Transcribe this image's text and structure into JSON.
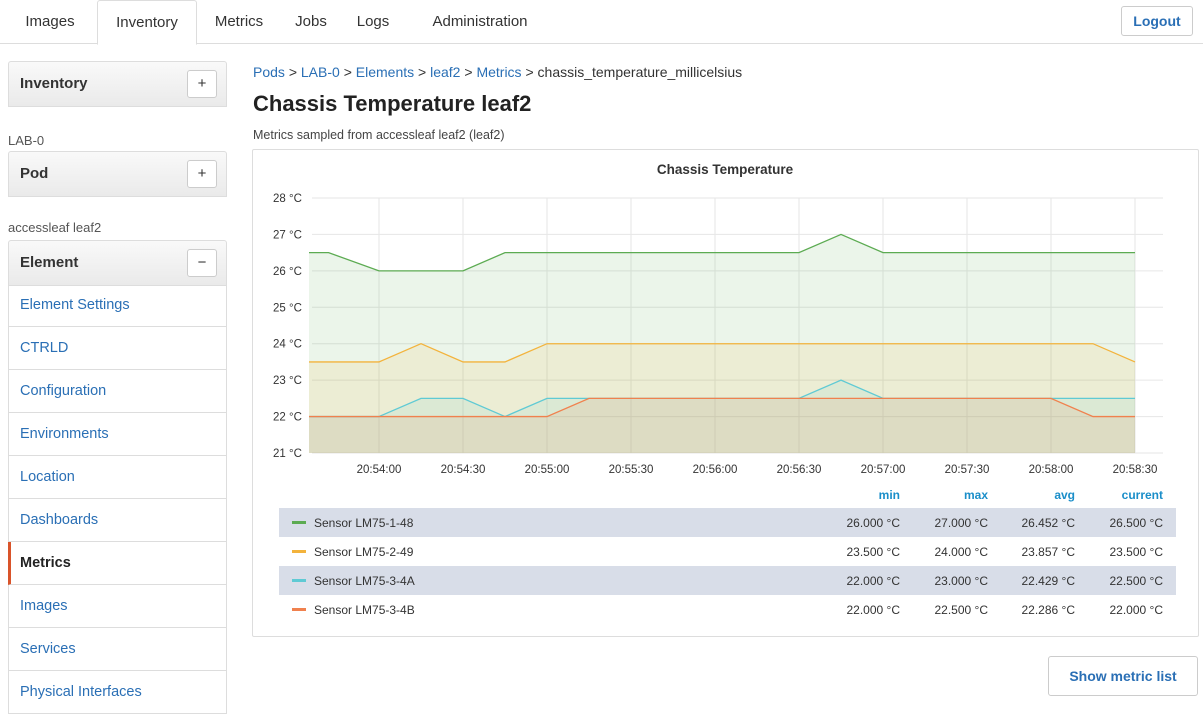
{
  "nav": {
    "tabs": [
      "Images",
      "Inventory",
      "Metrics",
      "Jobs",
      "Logs",
      "Administration"
    ],
    "active": "Inventory",
    "logout_label": "Logout"
  },
  "sidebar": {
    "inventory_title": "Inventory",
    "inventory_btn": "+",
    "pod_context": "LAB-0",
    "pod_title": "Pod",
    "pod_btn": "+",
    "element_context": "accessleaf leaf2",
    "element_title": "Element",
    "element_btn": "−",
    "items": [
      {
        "label": "Element Settings",
        "active": false
      },
      {
        "label": "CTRLD",
        "active": false
      },
      {
        "label": "Configuration",
        "active": false
      },
      {
        "label": "Environments",
        "active": false
      },
      {
        "label": "Location",
        "active": false
      },
      {
        "label": "Dashboards",
        "active": false
      },
      {
        "label": "Metrics",
        "active": true
      },
      {
        "label": "Images",
        "active": false
      },
      {
        "label": "Services",
        "active": false
      },
      {
        "label": "Physical Interfaces",
        "active": false
      }
    ]
  },
  "breadcrumb": {
    "items": [
      "Pods",
      "LAB-0",
      "Elements",
      "leaf2",
      "Metrics"
    ],
    "separator": ">",
    "current": "chassis_temperature_millicelsius"
  },
  "page": {
    "title": "Chassis Temperature leaf2",
    "subtitle": "Metrics sampled from accessleaf leaf2 (leaf2)"
  },
  "show_metric_list_label": "Show metric list",
  "chart_data": {
    "type": "area",
    "title": "Chassis Temperature",
    "y_ticks": [
      "21 °C",
      "22 °C",
      "23 °C",
      "24 °C",
      "25 °C",
      "26 °C",
      "27 °C",
      "28 °C"
    ],
    "ylim": [
      21,
      28
    ],
    "x_ticks": [
      "20:54:00",
      "20:54:30",
      "20:55:00",
      "20:55:30",
      "20:56:00",
      "20:56:30",
      "20:57:00",
      "20:57:30",
      "20:58:00",
      "20:58:30"
    ],
    "x": [
      "20:53:35",
      "20:53:42",
      "20:54:00",
      "20:54:15",
      "20:54:30",
      "20:54:45",
      "20:55:00",
      "20:55:15",
      "20:55:30",
      "20:55:45",
      "20:56:00",
      "20:56:15",
      "20:56:30",
      "20:56:45",
      "20:57:00",
      "20:57:15",
      "20:57:30",
      "20:57:45",
      "20:58:00",
      "20:58:15",
      "20:58:30"
    ],
    "grid": true,
    "legend_columns": [
      "min",
      "max",
      "avg",
      "current"
    ],
    "series": [
      {
        "name": "Sensor LM75-1-48",
        "color": "#5cab52",
        "values": [
          26.5,
          26.5,
          26.0,
          26.0,
          26.0,
          26.5,
          26.5,
          26.5,
          26.5,
          26.5,
          26.5,
          26.5,
          26.5,
          27.0,
          26.5,
          26.5,
          26.5,
          26.5,
          26.5,
          26.5,
          26.5
        ],
        "stats": [
          "26.000 °C",
          "27.000 °C",
          "26.452 °C",
          "26.500 °C"
        ]
      },
      {
        "name": "Sensor LM75-2-49",
        "color": "#f3b33c",
        "values": [
          23.5,
          23.5,
          23.5,
          24.0,
          23.5,
          23.5,
          24.0,
          24.0,
          24.0,
          24.0,
          24.0,
          24.0,
          24.0,
          24.0,
          24.0,
          24.0,
          24.0,
          24.0,
          24.0,
          24.0,
          23.5
        ],
        "stats": [
          "23.500 °C",
          "24.000 °C",
          "23.857 °C",
          "23.500 °C"
        ]
      },
      {
        "name": "Sensor LM75-3-4A",
        "color": "#5fcad4",
        "values": [
          22.0,
          22.0,
          22.0,
          22.5,
          22.5,
          22.0,
          22.5,
          22.5,
          22.5,
          22.5,
          22.5,
          22.5,
          22.5,
          23.0,
          22.5,
          22.5,
          22.5,
          22.5,
          22.5,
          22.5,
          22.5
        ],
        "stats": [
          "22.000 °C",
          "23.000 °C",
          "22.429 °C",
          "22.500 °C"
        ]
      },
      {
        "name": "Sensor LM75-3-4B",
        "color": "#f0814e",
        "values": [
          22.0,
          22.0,
          22.0,
          22.0,
          22.0,
          22.0,
          22.0,
          22.5,
          22.5,
          22.5,
          22.5,
          22.5,
          22.5,
          22.5,
          22.5,
          22.5,
          22.5,
          22.5,
          22.5,
          22.0,
          22.0
        ],
        "stats": [
          "22.000 °C",
          "22.500 °C",
          "22.286 °C",
          "22.000 °C"
        ]
      }
    ]
  }
}
